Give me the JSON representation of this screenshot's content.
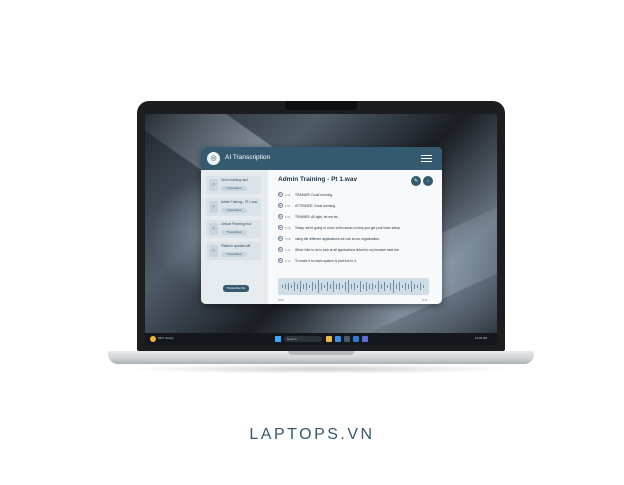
{
  "app": {
    "title": "AI Transcription",
    "logo_icon": "microphone-icon",
    "menu_icon": "hamburger-menu-icon"
  },
  "sidebar": {
    "items": [
      {
        "name": "Onion training mp4",
        "status": "Transcribed"
      },
      {
        "name": "Admin Training - Pt 1.wav",
        "status": "Transcribed"
      },
      {
        "name": "Lesson Planning mov",
        "status": "Transcribed"
      },
      {
        "name": "Platform updates.aiff",
        "status": "Transcribed"
      }
    ],
    "button_label": "Transcribe file"
  },
  "main": {
    "title": "Admin Training - Pt 1.wav",
    "transcript": [
      {
        "time": "0:01",
        "text": "TRAINER: Good morning."
      },
      {
        "time": "0:02",
        "text": "ATTENDEE: Good morning."
      },
      {
        "time": "0:04",
        "text": "TRAINER: All right, let me be..."
      },
      {
        "time": "0:06",
        "text": "Today, we're going to cover a few areas to help you get your team setup"
      },
      {
        "time": "0:08",
        "text": "using the different applications we use at our organization."
      },
      {
        "time": "0:10",
        "text": "What I like to do is look at all applications linked to my browser task bar"
      },
      {
        "time": "0:12",
        "text": "To make it so each system is part live in it."
      }
    ],
    "waveform_start": "0:00",
    "waveform_end": "0:14"
  },
  "taskbar": {
    "weather": "69°F Sunny",
    "search_placeholder": "Search",
    "tray": "12:30 PM"
  },
  "brand": {
    "text": "LAPTOPS.VN"
  },
  "colors": {
    "accent": "#345a70",
    "window_bg": "#f4f6f8",
    "sidebar_bg": "#e6ebef",
    "waveform_bg": "#cfdde6",
    "brand": "#36566e"
  }
}
